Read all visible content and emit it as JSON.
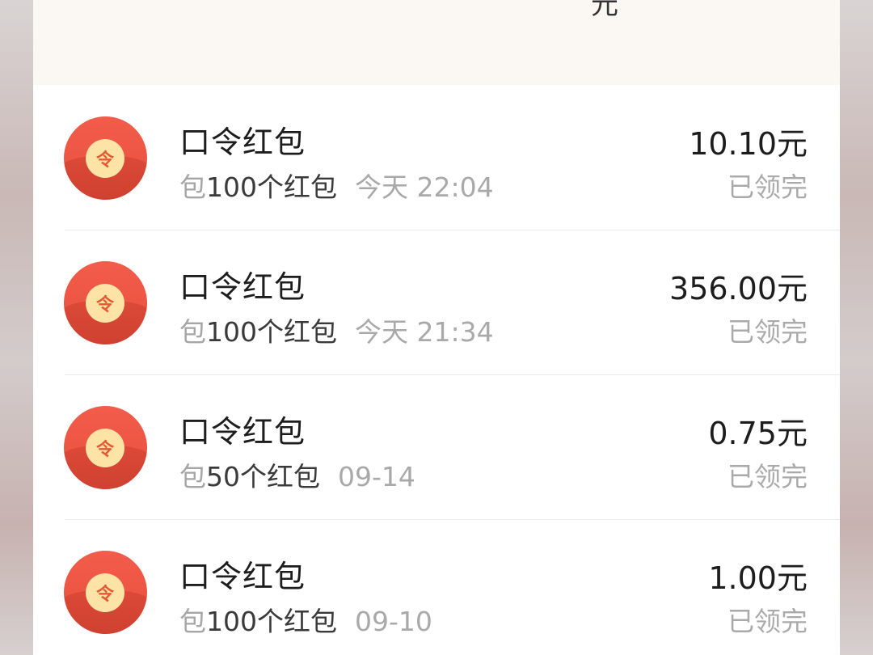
{
  "header": {
    "partial_text": "元"
  },
  "list": {
    "items": [
      {
        "title": "口令红包",
        "prefix": "包",
        "count": "100个红包",
        "time": "今天 22:04",
        "amount": "10.10元",
        "status": "已领完",
        "icon_glyph": "令"
      },
      {
        "title": "口令红包",
        "prefix": "包",
        "count": "100个红包",
        "time": "今天 21:34",
        "amount": "356.00元",
        "status": "已领完",
        "icon_glyph": "令"
      },
      {
        "title": "口令红包",
        "prefix": "包",
        "count": "50个红包",
        "time": "09-14",
        "amount": "0.75元",
        "status": "已领完",
        "icon_glyph": "令"
      },
      {
        "title": "口令红包",
        "prefix": "包",
        "count": "100个红包",
        "time": "09-10",
        "amount": "1.00元",
        "status": "已领完",
        "icon_glyph": "令"
      }
    ]
  },
  "colors": {
    "envelope_red": "#ec5643",
    "coin_gold": "#fde3a6",
    "header_bg": "#fbf8f4"
  }
}
